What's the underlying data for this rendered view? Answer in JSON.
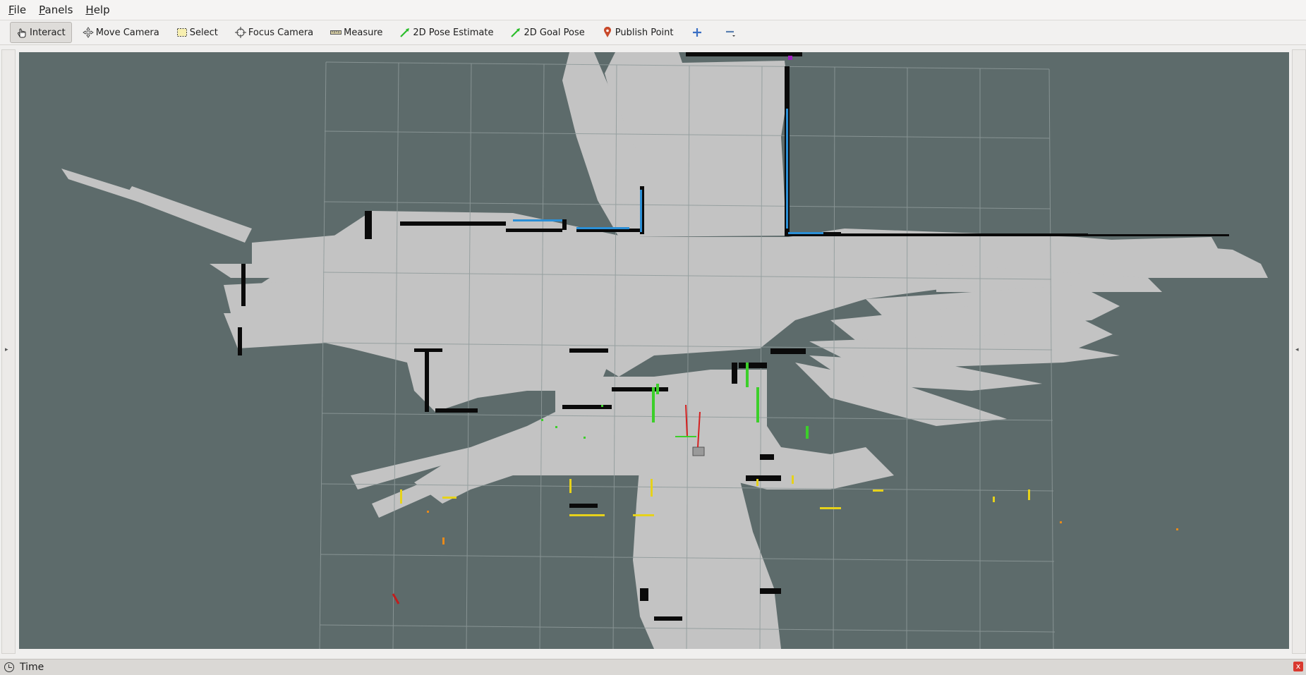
{
  "menu": {
    "file": {
      "pre": "",
      "ul": "F",
      "rest": "ile"
    },
    "panels": {
      "pre": "",
      "ul": "P",
      "rest": "anels"
    },
    "help": {
      "pre": "",
      "ul": "H",
      "rest": "elp"
    }
  },
  "toolbar": {
    "interact": "Interact",
    "move_camera": "Move Camera",
    "select": "Select",
    "focus_camera": "Focus Camera",
    "measure": "Measure",
    "pose_estimate": "2D Pose Estimate",
    "goal_pose": "2D Goal Pose",
    "publish_point": "Publish Point"
  },
  "status": {
    "time_label": "Time",
    "close_glyph": "x"
  },
  "colors": {
    "unknown": "#5d6b6b",
    "free": "#c3c3c3",
    "occupied": "#0a0a0a",
    "grid": "#8f9a9a",
    "scan_blue": "#2b8fd6",
    "scan_green": "#3ccf2a",
    "scan_yellow": "#e6d21b",
    "scan_orange": "#e88a1a"
  },
  "icons": {
    "interact": "hand-pointer-icon",
    "move_camera": "move-arrows-icon",
    "select": "selection-rect-icon",
    "focus_camera": "crosshair-icon",
    "measure": "ruler-icon",
    "pose_estimate": "green-arrow-icon",
    "goal_pose": "green-arrow-icon",
    "publish_point": "map-pin-icon",
    "add_tool": "plus-icon",
    "remove_tool": "minus-icon",
    "time": "clock-icon"
  }
}
